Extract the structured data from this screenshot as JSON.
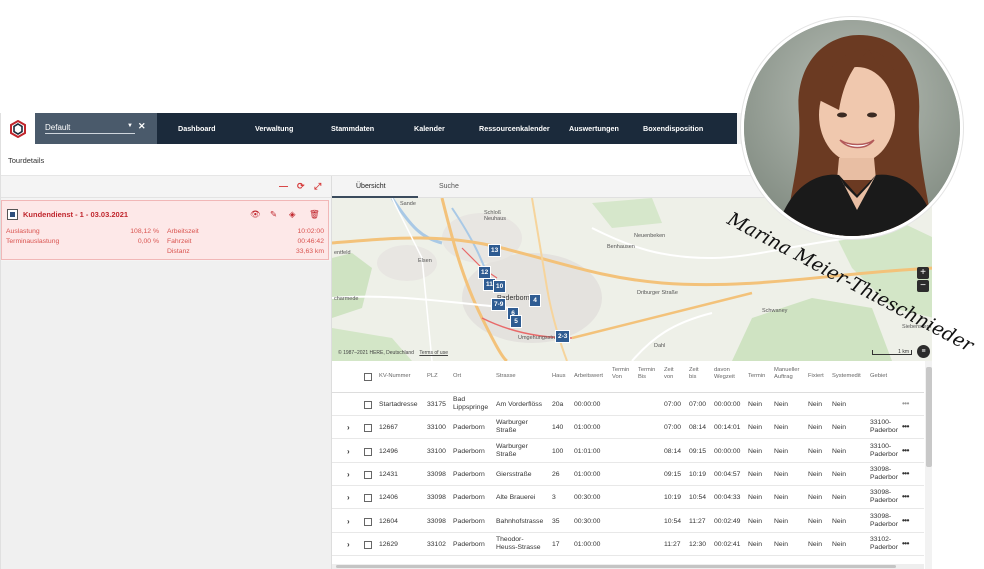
{
  "navbar": {
    "profile": "Default",
    "items": [
      "Dashboard",
      "Verwaltung",
      "Stammdaten",
      "Kalender",
      "Ressourcenkalender",
      "Auswertungen",
      "Boxendisposition"
    ]
  },
  "tourdetails": {
    "title": "Tourdetails"
  },
  "tour": {
    "name": "Kundendienst - 1 - 03.03.2021",
    "auslastung_label": "Auslastung",
    "auslastung_value": "108,12 %",
    "terminauslastung_label": "Terminauslastung",
    "terminauslastung_value": "0,00 %",
    "arbeitszeit_label": "Arbeitszeit",
    "arbeitszeit_value": "10:02:00",
    "fahrzeit_label": "Fahrzeit",
    "fahrzeit_value": "00:46:42",
    "distanz_label": "Distanz",
    "distanz_value": "33,63 km"
  },
  "tabs": {
    "overview": "Übersicht",
    "search": "Suche"
  },
  "map": {
    "labels": {
      "sande": "Sande",
      "schloss_neuhaus": "Schloß\nNeuhaus",
      "benhausen": "Benhausen",
      "neuenbeken": "Neuenbeken",
      "paderborn": "Paderborn",
      "elsen": "Elsen",
      "dahl": "Dahl",
      "schwaney": "Schwaney",
      "siebenstern": "Siebenstern",
      "dribuger": "Driburger Straße",
      "umgehung": "Umgehungsstraße",
      "schermede": "charmede",
      "wewer": "Wewer",
      "benteld": "entfeld",
      "rimbeck": "Rimbeck"
    },
    "pins": [
      "13",
      "12",
      "11",
      "10",
      "4",
      "7-9",
      "6",
      "5",
      "2-3"
    ],
    "attribution": "© 1987–2021 HERE, Deutschland",
    "terms": "Terms of use",
    "scale": "1 km",
    "zoom_in": "+",
    "zoom_out": "−"
  },
  "table": {
    "headers": {
      "kv": "KV-Nummer",
      "plz": "PLZ",
      "ort": "Ort",
      "strasse": "Strasse",
      "haus": "Haus",
      "arbeitswert": "Arbeitswert",
      "termin_von": "Termin\nVon",
      "termin_bis": "Termin\nBis",
      "zeit_von": "Zeit\nvon",
      "zeit_bis": "Zeit\nbis",
      "davon": "davon\nWegzeit",
      "termin": "Termin",
      "manueller": "Manueller\nAuftrag",
      "fixiert": "Fixiert",
      "systemedit": "Systemedit",
      "gebiet": "Gebiet"
    },
    "rows": [
      {
        "kv": "Startadresse",
        "plz": "33175",
        "ort": "Bad\nLippspringe",
        "strasse": "Am Vorderflöss",
        "haus": "20a",
        "arbeitswert": "00:00:00",
        "zeit_von": "07:00",
        "zeit_bis": "07:00",
        "davon": "00:00:00",
        "termin": "Nein",
        "manueller": "Nein",
        "fixiert": "Nein",
        "systemedit": "Nein",
        "gebiet": ""
      },
      {
        "kv": "12667",
        "plz": "33100",
        "ort": "Paderborn",
        "strasse": "Warburger\nStraße",
        "haus": "140",
        "arbeitswert": "01:00:00",
        "zeit_von": "07:00",
        "zeit_bis": "08:14",
        "davon": "00:14:01",
        "termin": "Nein",
        "manueller": "Nein",
        "fixiert": "Nein",
        "systemedit": "Nein",
        "gebiet": "33100-\nPaderbor"
      },
      {
        "kv": "12496",
        "plz": "33100",
        "ort": "Paderborn",
        "strasse": "Warburger\nStraße",
        "haus": "100",
        "arbeitswert": "01:01:00",
        "zeit_von": "08:14",
        "zeit_bis": "09:15",
        "davon": "00:00:00",
        "termin": "Nein",
        "manueller": "Nein",
        "fixiert": "Nein",
        "systemedit": "Nein",
        "gebiet": "33100-\nPaderbor"
      },
      {
        "kv": "12431",
        "plz": "33098",
        "ort": "Paderborn",
        "strasse": "Giersstraße",
        "haus": "26",
        "arbeitswert": "01:00:00",
        "zeit_von": "09:15",
        "zeit_bis": "10:19",
        "davon": "00:04:57",
        "termin": "Nein",
        "manueller": "Nein",
        "fixiert": "Nein",
        "systemedit": "Nein",
        "gebiet": "33098-\nPaderbor"
      },
      {
        "kv": "12406",
        "plz": "33098",
        "ort": "Paderborn",
        "strasse": "Alte Brauerei",
        "haus": "3",
        "arbeitswert": "00:30:00",
        "zeit_von": "10:19",
        "zeit_bis": "10:54",
        "davon": "00:04:33",
        "termin": "Nein",
        "manueller": "Nein",
        "fixiert": "Nein",
        "systemedit": "Nein",
        "gebiet": "33098-\nPaderbor"
      },
      {
        "kv": "12604",
        "plz": "33098",
        "ort": "Paderborn",
        "strasse": "Bahnhofstrasse",
        "haus": "35",
        "arbeitswert": "00:30:00",
        "zeit_von": "10:54",
        "zeit_bis": "11:27",
        "davon": "00:02:49",
        "termin": "Nein",
        "manueller": "Nein",
        "fixiert": "Nein",
        "systemedit": "Nein",
        "gebiet": "33098-\nPaderbor"
      },
      {
        "kv": "12629",
        "plz": "33102",
        "ort": "Paderborn",
        "strasse": "Theodor-\nHeuss-Strasse",
        "haus": "17",
        "arbeitswert": "01:00:00",
        "zeit_von": "11:27",
        "zeit_bis": "12:30",
        "davon": "00:02:41",
        "termin": "Nein",
        "manueller": "Nein",
        "fixiert": "Nein",
        "systemedit": "Nein",
        "gebiet": "33102-\nPaderbor"
      }
    ]
  },
  "person": {
    "signature": "Marina Meier-Thieschnieder"
  },
  "colors": {
    "navbar": "#1b2a3b",
    "profile": "#4a5a6b",
    "accent_red": "#c0262d",
    "pin": "#2f5c92"
  }
}
